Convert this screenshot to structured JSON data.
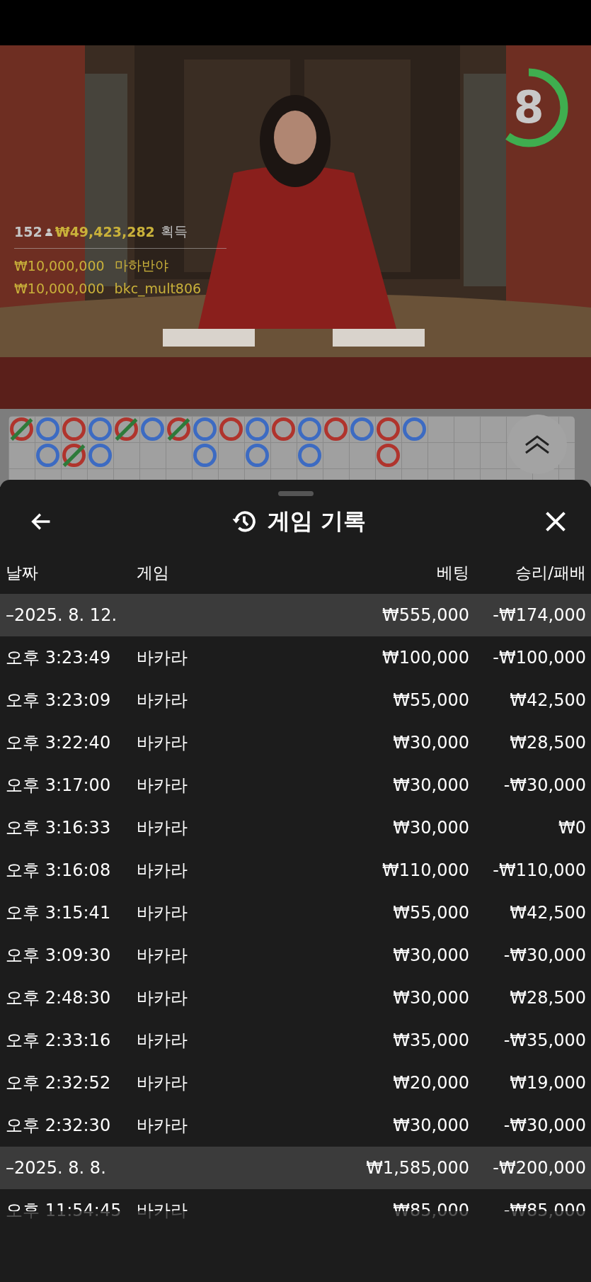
{
  "video": {
    "timer": {
      "count": "8",
      "level": 0.6
    },
    "winnings": {
      "players": "152",
      "total": "₩49,423,282",
      "label": "획득"
    },
    "winners": [
      {
        "amount": "₩10,000,000",
        "name": "마하반야"
      },
      {
        "amount": "₩10,000,000",
        "name": "bkc_mult806"
      }
    ]
  },
  "road": {
    "columns": [
      [
        {
          "color": "#b0342d",
          "tie": true
        }
      ],
      [
        {
          "color": "#3d6bc2",
          "tie": false
        },
        {
          "color": "#3d6bc2",
          "tie": false
        }
      ],
      [
        {
          "color": "#b0342d",
          "tie": false
        },
        {
          "color": "#b0342d",
          "tie": true
        }
      ],
      [
        {
          "color": "#3d6bc2",
          "tie": false
        },
        {
          "color": "#3d6bc2",
          "tie": false
        }
      ],
      [
        {
          "color": "#b0342d",
          "tie": true
        }
      ],
      [
        {
          "color": "#3d6bc2",
          "tie": false
        }
      ],
      [
        {
          "color": "#b0342d",
          "tie": true
        }
      ],
      [
        {
          "color": "#3d6bc2",
          "tie": false
        },
        {
          "color": "#3d6bc2",
          "tie": false
        }
      ],
      [
        {
          "color": "#b0342d",
          "tie": false
        }
      ],
      [
        {
          "color": "#3d6bc2",
          "tie": false
        },
        {
          "color": "#3d6bc2",
          "tie": false
        }
      ],
      [
        {
          "color": "#b0342d",
          "tie": false
        }
      ],
      [
        {
          "color": "#3d6bc2",
          "tie": false
        },
        {
          "color": "#3d6bc2",
          "tie": false
        }
      ],
      [
        {
          "color": "#b0342d",
          "tie": false
        }
      ],
      [
        {
          "color": "#3d6bc2",
          "tie": false
        }
      ],
      [
        {
          "color": "#b0342d",
          "tie": false
        },
        {
          "color": "#b0342d",
          "tie": false
        }
      ],
      [
        {
          "color": "#3d6bc2",
          "tie": false
        }
      ]
    ]
  },
  "sheet": {
    "title": "게임 기록",
    "columns": [
      "날짜",
      "게임",
      "베팅",
      "승리/패배"
    ],
    "groups": [
      {
        "date": "–2025. 8. 12.",
        "bet": "₩555,000",
        "result": "-₩174,000",
        "rows": [
          {
            "time": "오후 3:23:49",
            "game": "바카라",
            "bet": "₩100,000",
            "result": "-₩100,000"
          },
          {
            "time": "오후 3:23:09",
            "game": "바카라",
            "bet": "₩55,000",
            "result": "₩42,500"
          },
          {
            "time": "오후 3:22:40",
            "game": "바카라",
            "bet": "₩30,000",
            "result": "₩28,500"
          },
          {
            "time": "오후 3:17:00",
            "game": "바카라",
            "bet": "₩30,000",
            "result": "-₩30,000"
          },
          {
            "time": "오후 3:16:33",
            "game": "바카라",
            "bet": "₩30,000",
            "result": "₩0"
          },
          {
            "time": "오후 3:16:08",
            "game": "바카라",
            "bet": "₩110,000",
            "result": "-₩110,000"
          },
          {
            "time": "오후 3:15:41",
            "game": "바카라",
            "bet": "₩55,000",
            "result": "₩42,500"
          },
          {
            "time": "오후 3:09:30",
            "game": "바카라",
            "bet": "₩30,000",
            "result": "-₩30,000"
          },
          {
            "time": "오후 2:48:30",
            "game": "바카라",
            "bet": "₩30,000",
            "result": "₩28,500"
          },
          {
            "time": "오후 2:33:16",
            "game": "바카라",
            "bet": "₩35,000",
            "result": "-₩35,000"
          },
          {
            "time": "오후 2:32:52",
            "game": "바카라",
            "bet": "₩20,000",
            "result": "₩19,000"
          },
          {
            "time": "오후 2:32:30",
            "game": "바카라",
            "bet": "₩30,000",
            "result": "-₩30,000"
          }
        ]
      },
      {
        "date": "–2025. 8. 8.",
        "bet": "₩1,585,000",
        "result": "-₩200,000",
        "rows": [
          {
            "time": "오후 11:54:45",
            "game": "바카라",
            "bet": "₩85,000",
            "result": "-₩85,000"
          }
        ]
      }
    ]
  }
}
